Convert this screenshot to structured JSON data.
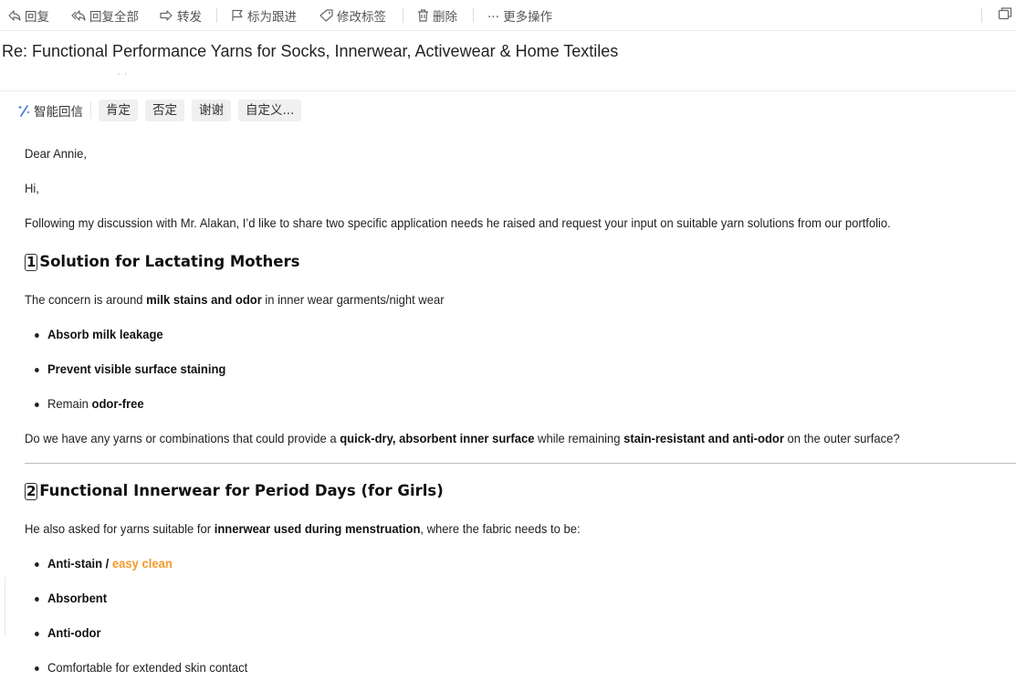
{
  "toolbar": {
    "reply": "回复",
    "reply_all": "回复全部",
    "forward": "转发",
    "flag": "标为跟进",
    "tag": "修改标签",
    "delete": "删除",
    "more": "··· 更多操作"
  },
  "subject": "Re: Functional Performance Yarns for Socks, Innerwear, Activewear & Home Textiles",
  "smart_reply": {
    "label": "智能回信",
    "options": [
      "肯定",
      "否定",
      "谢谢",
      "自定义..."
    ]
  },
  "email": {
    "salutation": "Dear Annie,",
    "greeting": "Hi,",
    "intro": "Following my discussion with Mr. Alakan, I’d like to share two specific application needs he raised and request your input on suitable yarn solutions from our portfolio.",
    "section1": {
      "num": "1",
      "title": "Solution for Lactating Mothers",
      "concern_pre": "The concern is around ",
      "concern_bold": "milk stains and odor",
      "concern_post": " in inner wear garments/night wear",
      "bullet1": "Absorb milk leakage",
      "bullet2": "Prevent visible surface staining",
      "bullet3_pre": "Remain ",
      "bullet3_bold": "odor-free",
      "question_pre": "Do we have any yarns or combinations that could provide a ",
      "question_bold1": "quick-dry, absorbent inner surface",
      "question_mid": " while remaining ",
      "question_bold2": "stain-resistant and anti-odor",
      "question_post": " on the outer surface?"
    },
    "section2": {
      "num": "2",
      "title": "Functional Innerwear for Period Days (for Girls)",
      "ask_pre": "He also asked for yarns suitable for ",
      "ask_bold": "innerwear used during menstruation",
      "ask_post": ", where the fabric needs to be:",
      "bullet1_bold": "Anti-stain / ",
      "bullet1_orange": "easy clean",
      "bullet2": "Absorbent",
      "bullet3": "Anti-odor",
      "bullet4": "Comfortable for extended skin contact"
    }
  }
}
